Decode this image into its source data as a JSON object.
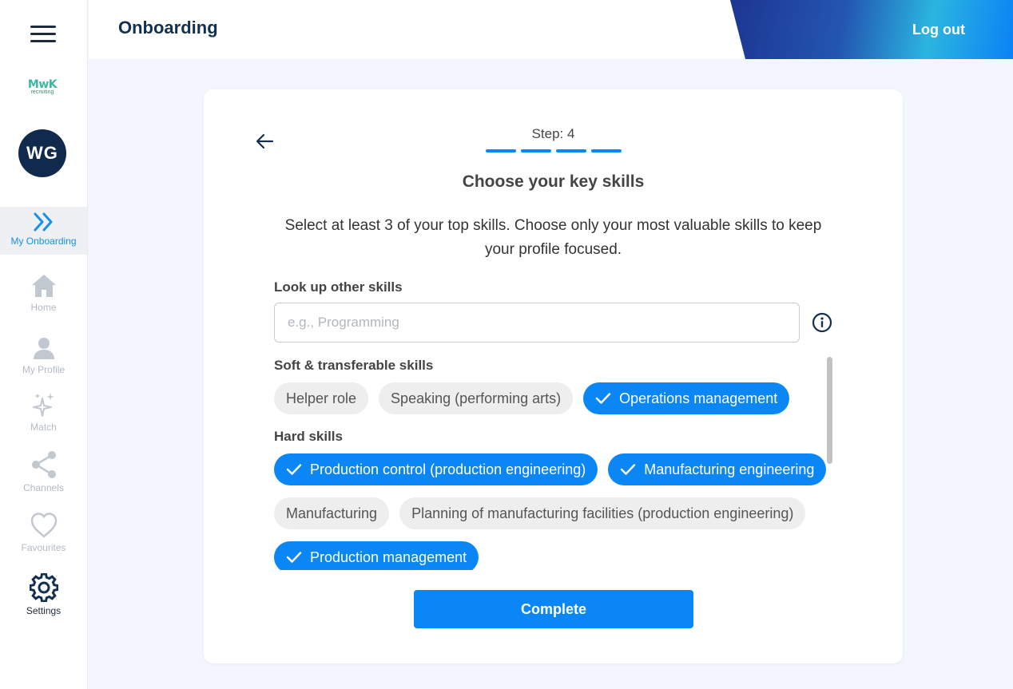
{
  "sidebar": {
    "logo_text": "MwK",
    "logo_sub": "recruiting",
    "avatar_initials": "WG",
    "items": [
      {
        "label": "My Onboarding",
        "icon": "double-chevron-right-icon",
        "active": true
      },
      {
        "label": "Home",
        "icon": "home-icon"
      },
      {
        "label": "My Profile",
        "icon": "person-icon"
      },
      {
        "label": "Match",
        "icon": "sparkles-icon"
      },
      {
        "label": "Channels",
        "icon": "share-icon"
      },
      {
        "label": "Favourites",
        "icon": "heart-icon"
      },
      {
        "label": "Settings",
        "icon": "gear-icon"
      }
    ]
  },
  "header": {
    "title": "Onboarding",
    "logout_label": "Log out"
  },
  "card": {
    "step_label": "Step: 4",
    "steps_completed": 4,
    "title": "Choose your key skills",
    "description": "Select at least 3 of your top skills. Choose only your most valuable skills to keep your profile focused.",
    "lookup": {
      "label": "Look up other skills",
      "placeholder": "e.g., Programming",
      "value": ""
    },
    "sections": [
      {
        "label": "Soft & transferable skills",
        "skills": [
          {
            "label": "Helper role",
            "selected": false
          },
          {
            "label": "Speaking (performing arts)",
            "selected": false
          },
          {
            "label": "Operations management",
            "selected": true
          }
        ]
      },
      {
        "label": "Hard skills",
        "skills": [
          {
            "label": "Production control (production engineering)",
            "selected": true
          },
          {
            "label": "Manufacturing engineering",
            "selected": true
          },
          {
            "label": "Manufacturing",
            "selected": false
          },
          {
            "label": "Planning of manufacturing facilities (production engineering)",
            "selected": false
          },
          {
            "label": "Production management",
            "selected": true
          }
        ]
      }
    ],
    "complete_label": "Complete"
  },
  "colors": {
    "accent": "#0a87f5",
    "navy": "#102a4d",
    "chip_bg": "#eeeeee"
  }
}
